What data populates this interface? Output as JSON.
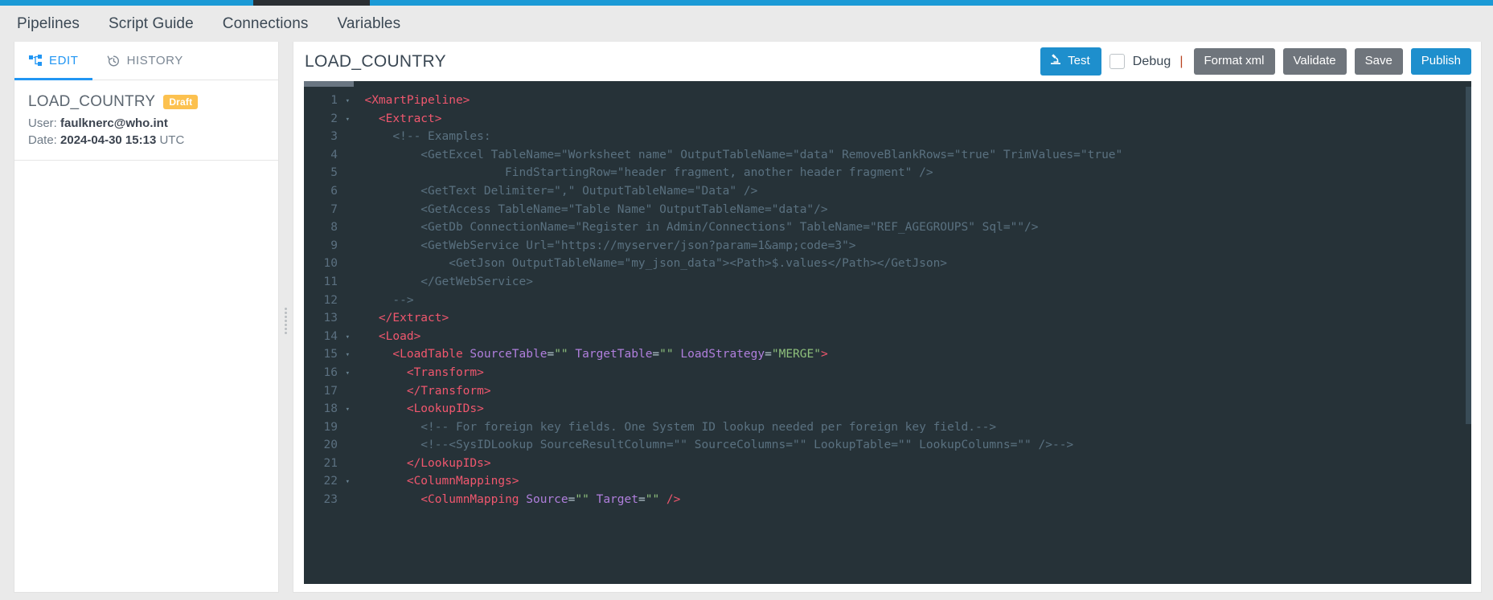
{
  "top_strip": {
    "colors": {
      "blue": "#1b9ad6",
      "dark": "#2b2f33"
    }
  },
  "global_nav": {
    "items": [
      {
        "label": "Pipelines"
      },
      {
        "label": "Script Guide"
      },
      {
        "label": "Connections"
      },
      {
        "label": "Variables"
      }
    ]
  },
  "left_panel": {
    "tabs": [
      {
        "label": "EDIT",
        "icon": "pipeline-icon",
        "active": true
      },
      {
        "label": "HISTORY",
        "icon": "history-icon",
        "active": false
      }
    ],
    "meta": {
      "name": "LOAD_COUNTRY",
      "status_badge": "Draft",
      "status_badge_color": "#fcc14f",
      "user_label": "User:",
      "user_value": "faulknerc@who.int",
      "date_label": "Date:",
      "date_value": "2024-04-30 15:13",
      "date_suffix": "UTC"
    }
  },
  "editor": {
    "title": "LOAD_COUNTRY",
    "toolbar": {
      "test_label": "Test",
      "test_icon": "microscope-icon",
      "debug_label": "Debug",
      "debug_checked": false,
      "separator": "|",
      "format_xml_label": "Format xml",
      "validate_label": "Validate",
      "save_label": "Save",
      "publish_label": "Publish",
      "colors": {
        "primary": "#1e8fcd",
        "grey": "#6f757c"
      }
    },
    "lines": [
      {
        "n": 1,
        "fold": true,
        "tokens": [
          {
            "t": "pl",
            "v": "  "
          },
          {
            "t": "tg",
            "v": "<XmartPipeline>"
          }
        ]
      },
      {
        "n": 2,
        "fold": true,
        "tokens": [
          {
            "t": "pl",
            "v": "    "
          },
          {
            "t": "tg",
            "v": "<Extract>"
          }
        ]
      },
      {
        "n": 3,
        "fold": false,
        "tokens": [
          {
            "t": "cm",
            "v": "      <!-- Examples:"
          }
        ]
      },
      {
        "n": 4,
        "fold": false,
        "tokens": [
          {
            "t": "cm",
            "v": "          <GetExcel TableName=\"Worksheet name\" OutputTableName=\"data\" RemoveBlankRows=\"true\" TrimValues=\"true\""
          }
        ]
      },
      {
        "n": 5,
        "fold": false,
        "tokens": [
          {
            "t": "cm",
            "v": "                      FindStartingRow=\"header fragment, another header fragment\" />"
          }
        ]
      },
      {
        "n": 6,
        "fold": false,
        "tokens": [
          {
            "t": "cm",
            "v": "          <GetText Delimiter=\",\" OutputTableName=\"Data\" />"
          }
        ]
      },
      {
        "n": 7,
        "fold": false,
        "tokens": [
          {
            "t": "cm",
            "v": "          <GetAccess TableName=\"Table Name\" OutputTableName=\"data\"/>"
          }
        ]
      },
      {
        "n": 8,
        "fold": false,
        "tokens": [
          {
            "t": "cm",
            "v": "          <GetDb ConnectionName=\"Register in Admin/Connections\" TableName=\"REF_AGEGROUPS\" Sql=\"\"/>"
          }
        ]
      },
      {
        "n": 9,
        "fold": false,
        "tokens": [
          {
            "t": "cm",
            "v": "          <GetWebService Url=\"https://myserver/json?param=1&amp;code=3\">"
          }
        ]
      },
      {
        "n": 10,
        "fold": false,
        "tokens": [
          {
            "t": "cm",
            "v": "              <GetJson OutputTableName=\"my_json_data\"><Path>$.values</Path></GetJson>"
          }
        ]
      },
      {
        "n": 11,
        "fold": false,
        "tokens": [
          {
            "t": "cm",
            "v": "          </GetWebService>"
          }
        ]
      },
      {
        "n": 12,
        "fold": false,
        "tokens": [
          {
            "t": "cm",
            "v": "      -->"
          }
        ]
      },
      {
        "n": 13,
        "fold": false,
        "tokens": [
          {
            "t": "pl",
            "v": "    "
          },
          {
            "t": "tg",
            "v": "</Extract>"
          }
        ]
      },
      {
        "n": 14,
        "fold": true,
        "tokens": [
          {
            "t": "pl",
            "v": "    "
          },
          {
            "t": "tg",
            "v": "<Load>"
          }
        ]
      },
      {
        "n": 15,
        "fold": true,
        "tokens": [
          {
            "t": "pl",
            "v": "      "
          },
          {
            "t": "tg",
            "v": "<LoadTable "
          },
          {
            "t": "at",
            "v": "SourceTable"
          },
          {
            "t": "pl",
            "v": "="
          },
          {
            "t": "st",
            "v": "\"\""
          },
          {
            "t": "pl",
            "v": " "
          },
          {
            "t": "at",
            "v": "TargetTable"
          },
          {
            "t": "pl",
            "v": "="
          },
          {
            "t": "st",
            "v": "\"\""
          },
          {
            "t": "pl",
            "v": " "
          },
          {
            "t": "at",
            "v": "LoadStrategy"
          },
          {
            "t": "pl",
            "v": "="
          },
          {
            "t": "st",
            "v": "\"MERGE\""
          },
          {
            "t": "tg",
            "v": ">"
          }
        ]
      },
      {
        "n": 16,
        "fold": true,
        "tokens": [
          {
            "t": "pl",
            "v": "        "
          },
          {
            "t": "tg",
            "v": "<Transform>"
          }
        ]
      },
      {
        "n": 17,
        "fold": false,
        "tokens": [
          {
            "t": "pl",
            "v": "        "
          },
          {
            "t": "tg",
            "v": "</Transform>"
          }
        ]
      },
      {
        "n": 18,
        "fold": true,
        "tokens": [
          {
            "t": "pl",
            "v": "        "
          },
          {
            "t": "tg",
            "v": "<LookupIDs>"
          }
        ]
      },
      {
        "n": 19,
        "fold": false,
        "tokens": [
          {
            "t": "cm",
            "v": "          <!-- For foreign key fields. One System ID lookup needed per foreign key field.-->"
          }
        ]
      },
      {
        "n": 20,
        "fold": false,
        "tokens": [
          {
            "t": "cm",
            "v": "          <!--<SysIDLookup SourceResultColumn=\"\" SourceColumns=\"\" LookupTable=\"\" LookupColumns=\"\" />-->"
          }
        ]
      },
      {
        "n": 21,
        "fold": false,
        "tokens": [
          {
            "t": "pl",
            "v": "        "
          },
          {
            "t": "tg",
            "v": "</LookupIDs>"
          }
        ]
      },
      {
        "n": 22,
        "fold": true,
        "tokens": [
          {
            "t": "pl",
            "v": "        "
          },
          {
            "t": "tg",
            "v": "<ColumnMappings>"
          }
        ]
      },
      {
        "n": 23,
        "fold": false,
        "tokens": [
          {
            "t": "pl",
            "v": "          "
          },
          {
            "t": "tg",
            "v": "<ColumnMapping "
          },
          {
            "t": "at",
            "v": "Source"
          },
          {
            "t": "pl",
            "v": "="
          },
          {
            "t": "st",
            "v": "\"\""
          },
          {
            "t": "pl",
            "v": " "
          },
          {
            "t": "at",
            "v": "Target"
          },
          {
            "t": "pl",
            "v": "="
          },
          {
            "t": "st",
            "v": "\"\""
          },
          {
            "t": "pl",
            "v": " "
          },
          {
            "t": "tg",
            "v": "/>"
          }
        ]
      }
    ]
  }
}
